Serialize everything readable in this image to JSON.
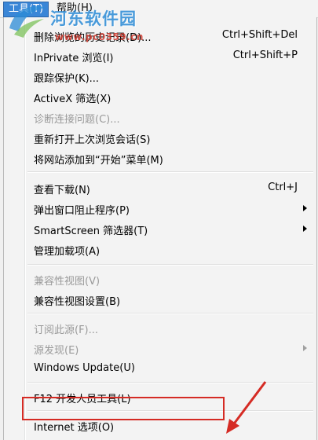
{
  "menubar": {
    "tools_label": "工具(T)",
    "help_label": "帮助(H)"
  },
  "watermark": {
    "title": "河东软件园",
    "url": "www.pc0359.cn"
  },
  "menu": {
    "items": [
      {
        "label": "删除浏览的历史记录(D)...",
        "shortcut": "Ctrl+Shift+Del",
        "disabled": false
      },
      {
        "label": "InPrivate 浏览(I)",
        "shortcut": "Ctrl+Shift+P",
        "disabled": false
      },
      {
        "label": "跟踪保护(K)...",
        "shortcut": "",
        "disabled": false
      },
      {
        "label": "ActiveX 筛选(X)",
        "shortcut": "",
        "disabled": false
      },
      {
        "label": "诊断连接问题(C)...",
        "shortcut": "",
        "disabled": true
      },
      {
        "label": "重新打开上次浏览会话(S)",
        "shortcut": "",
        "disabled": false
      },
      {
        "label": "将网站添加到“开始”菜单(M)",
        "shortcut": "",
        "disabled": false
      },
      {
        "label": "查看下载(N)",
        "shortcut": "Ctrl+J",
        "disabled": false
      },
      {
        "label": "弹出窗口阻止程序(P)",
        "shortcut": "",
        "disabled": false,
        "submenu": true
      },
      {
        "label": "SmartScreen 筛选器(T)",
        "shortcut": "",
        "disabled": false,
        "submenu": true
      },
      {
        "label": "管理加载项(A)",
        "shortcut": "",
        "disabled": false
      },
      {
        "label": "兼容性视图(V)",
        "shortcut": "",
        "disabled": true
      },
      {
        "label": "兼容性视图设置(B)",
        "shortcut": "",
        "disabled": false
      },
      {
        "label": "订阅此源(F)...",
        "shortcut": "",
        "disabled": true
      },
      {
        "label": "源发现(E)",
        "shortcut": "",
        "disabled": true,
        "submenu": true
      },
      {
        "label": "Windows Update(U)",
        "shortcut": "",
        "disabled": false
      },
      {
        "label": "F12 开发人员工具(L)",
        "shortcut": "",
        "disabled": false
      },
      {
        "label": "Internet 选项(O)",
        "shortcut": "",
        "disabled": false
      }
    ]
  },
  "colors": {
    "highlight_border": "#d52b24",
    "menubar_active": "#3a86d7"
  }
}
